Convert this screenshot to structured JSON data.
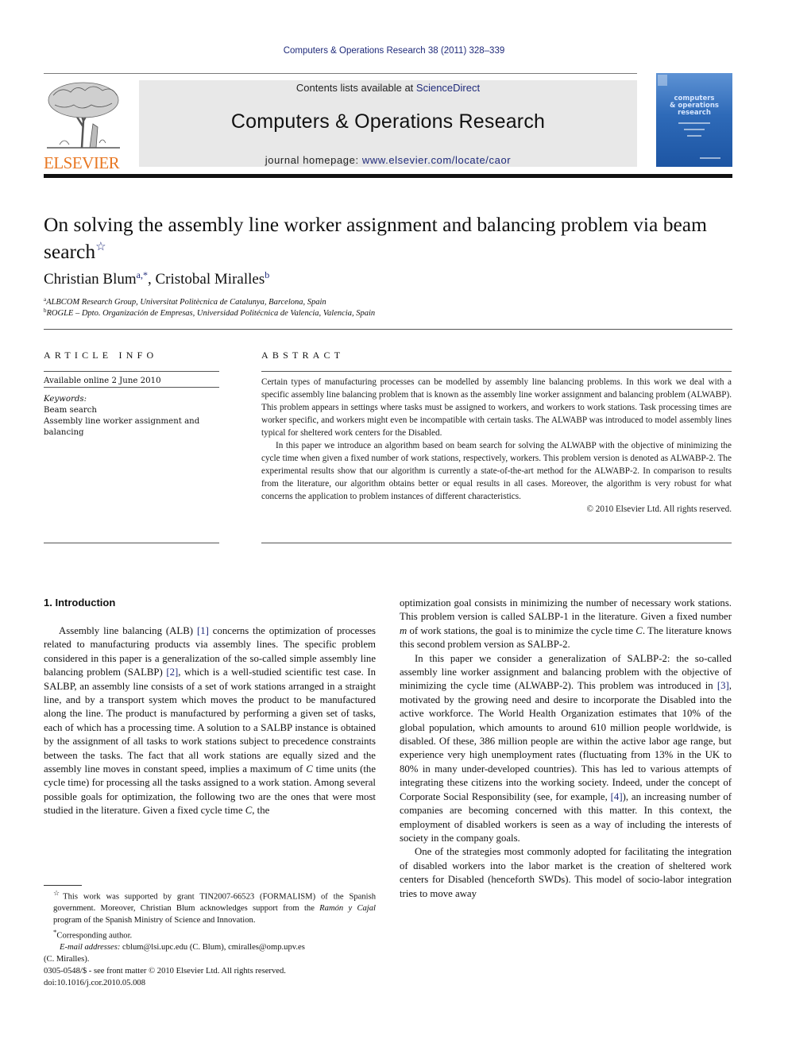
{
  "header": {
    "journal_reference": "Computers & Operations Research 38 (2011) 328–339",
    "contents_prefix": "Contents lists available at ",
    "contents_link": "ScienceDirect",
    "journal_title": "Computers & Operations Research",
    "homepage_prefix": "journal homepage: ",
    "homepage_link": "www.elsevier.com/locate/caor",
    "publisher_logo_text": "ELSEVIER",
    "cover_title_lines": [
      "computers",
      "& operations",
      "research"
    ],
    "logo_color": "#e87722",
    "link_color": "#1f2a7a",
    "cover_color": "#2e6ab8"
  },
  "article": {
    "title": "On solving the assembly line worker assignment and balancing problem via beam search",
    "title_marker": "☆",
    "authors": [
      {
        "name": "Christian Blum",
        "sup": "a,*",
        "separator": ", "
      },
      {
        "name": "Cristobal Miralles",
        "sup": "b",
        "separator": ""
      }
    ],
    "affiliations": [
      {
        "sup": "a",
        "text": "ALBCOM Research Group, Universitat Politècnica de Catalunya, Barcelona, Spain"
      },
      {
        "sup": "b",
        "text": "ROGLE – Dpto. Organización de Empresas, Universidad Politécnica de Valencia, Valencia, Spain"
      }
    ]
  },
  "article_info": {
    "heading": "ARTICLE INFO",
    "available_online": "Available online 2 June 2010",
    "keywords_label": "Keywords:",
    "keywords": [
      "Beam search",
      "Assembly line worker assignment and balancing"
    ]
  },
  "abstract": {
    "heading": "ABSTRACT",
    "paragraphs": [
      "Certain types of manufacturing processes can be modelled by assembly line balancing problems. In this work we deal with a specific assembly line balancing problem that is known as the assembly line worker assignment and balancing problem (ALWABP). This problem appears in settings where tasks must be assigned to workers, and workers to work stations. Task processing times are worker specific, and workers might even be incompatible with certain tasks. The ALWABP was introduced to model assembly lines typical for sheltered work centers for the Disabled.",
      "In this paper we introduce an algorithm based on beam search for solving the ALWABP with the objective of minimizing the cycle time when given a fixed number of work stations, respectively, workers. This problem version is denoted as ALWABP-2. The experimental results show that our algorithm is currently a state-of-the-art method for the ALWABP-2. In comparison to results from the literature, our algorithm obtains better or equal results in all cases. Moreover, the algorithm is very robust for what concerns the application to problem instances of different characteristics."
    ],
    "copyright": "© 2010 Elsevier Ltd. All rights reserved."
  },
  "body": {
    "section_heading": "1.  Introduction",
    "left": {
      "p1_a": "Assembly line balancing (ALB) ",
      "p1_ref1": "[1]",
      "p1_b": " concerns the optimization of processes related to manufacturing products via assembly lines. The specific problem considered in this paper is a generalization of the so-called simple assembly line balancing problem (SALBP) ",
      "p1_ref2": "[2]",
      "p1_c": ", which is a well-studied scientific test case. In SALBP, an assembly line consists of a set of work stations arranged in a straight line, and by a transport system which moves the product to be manufactured along the line. The product is manufactured by performing a given set of tasks, each of which has a processing time. A solution to a SALBP instance is obtained by the assignment of all tasks to work stations subject to precedence constraints between the tasks. The fact that all work stations are equally sized and the assembly line moves in constant speed, implies a maximum of ",
      "p1_C1": "C",
      "p1_d": " time units (the cycle time) for processing all the tasks assigned to a work station. Among several possible goals for optimization, the following two are the ones that were most studied in the literature. Given a fixed cycle time ",
      "p1_C2": "C",
      "p1_e": ", the"
    },
    "right": {
      "p1_a": "optimization goal consists in minimizing the number of necessary work stations. This problem version is called SALBP-1 in the literature. Given a fixed number ",
      "p1_m": "m",
      "p1_b": " of work stations, the goal is to minimize the cycle time ",
      "p1_C": "C",
      "p1_c": ". The literature knows this second problem version as SALBP-2.",
      "p2_a": "In this paper we consider a generalization of SALBP-2: the so-called assembly line worker assignment and balancing problem with the objective of minimizing the cycle time (ALWABP-2). This problem was introduced in ",
      "p2_ref3": "[3]",
      "p2_b": ", motivated by the growing need and desire to incorporate the Disabled into the active workforce. The World Health Organization estimates that 10% of the global population, which amounts to around 610 million people worldwide, is disabled. Of these, 386 million people are within the active labor age range, but experience very high unemployment rates (fluctuating from 13% in the UK to 80% in many under-developed countries). This has led to various attempts of integrating these citizens into the working society. Indeed, under the concept of Corporate Social Responsibility (see, for example, ",
      "p2_ref4": "[4]",
      "p2_c": "), an increasing number of companies are becoming concerned with this matter. In this context, the employment of disabled workers is seen as a way of including the interests of society in the company goals.",
      "p3": "One of the strategies most commonly adopted for facilitating the integration of disabled workers into the labor market is the creation of sheltered work centers for Disabled (henceforth SWDs). This model of socio-labor integration tries to move away"
    }
  },
  "footnotes": {
    "funding_marker": "☆",
    "funding_a": "This work was supported by grant TIN2007-66523 (FORMALISM) of the Spanish government. Moreover, Christian Blum acknowledges support from the ",
    "funding_italic": "Ramón y Cajal",
    "funding_b": " program of the Spanish Ministry of Science and Innovation.",
    "corresponding_marker": "*",
    "corresponding": "Corresponding author.",
    "email_label": "E-mail addresses:",
    "email_text": " cblum@lsi.upc.edu (C. Blum), cmiralles@omp.upv.es",
    "email_text2": "(C. Miralles).",
    "front_matter": "0305-0548/$ - see front matter © 2010 Elsevier Ltd. All rights reserved.",
    "doi": "doi:10.1016/j.cor.2010.05.008"
  }
}
